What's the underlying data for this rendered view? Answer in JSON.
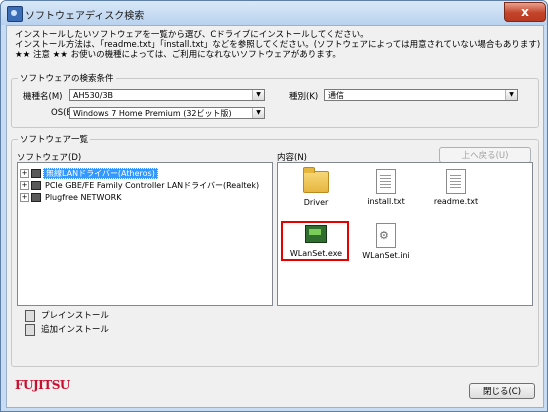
{
  "window": {
    "title": "ソフトウェアディスク検索",
    "close_label": "x"
  },
  "intro": {
    "line1": "インストールしたいソフトウェアを一覧から選び、Cドライブにインストールしてください。",
    "line2": "インストール方法は、「readme.txt」「install.txt」などを参照してください。(ソフトウェアによっては用意されていない場合もあります)",
    "line3": "★★ 注意 ★★ お使いの機種によっては、ご利用になれないソフトウェアがあります。"
  },
  "search": {
    "legend": "ソフトウェアの検索条件",
    "model_label": "機種名(M)",
    "model_value": "AH530/3B",
    "type_label": "種別(K)",
    "type_value": "通信",
    "os_label": "OS(E)",
    "os_value": "Windows 7 Home Premium (32ビット版)"
  },
  "list": {
    "legend": "ソフトウェア一覧",
    "software_label": "ソフトウェア(D)",
    "contents_label": "内容(N)",
    "up_button": "上へ戻る(U)",
    "tree": [
      {
        "label": "無線LANドライバー(Atheros)",
        "selected": true
      },
      {
        "label": "PCIe GBE/FE Family Controller LANドライバー(Realtek)",
        "selected": false
      },
      {
        "label": "Plugfree NETWORK",
        "selected": false
      }
    ],
    "files": [
      {
        "name": "Driver",
        "icon": "folder-icon"
      },
      {
        "name": "install.txt",
        "icon": "text-file-icon"
      },
      {
        "name": "readme.txt",
        "icon": "text-file-icon"
      },
      {
        "name": "WLanSet.exe",
        "icon": "exe-file-icon"
      },
      {
        "name": "WLanSet.ini",
        "icon": "ini-file-icon"
      }
    ]
  },
  "actions": {
    "preinstall": "プレインストール",
    "add_install": "追加インストール"
  },
  "footer": {
    "logo": "FUJITSU",
    "close_button": "閉じる(C)"
  },
  "colors": {
    "highlight": "#e60000",
    "selection": "#3399ff",
    "logo": "#c8102e"
  }
}
